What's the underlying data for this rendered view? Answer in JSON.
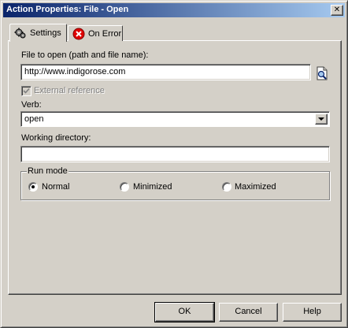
{
  "window": {
    "title": "Action Properties: File - Open",
    "close_label": "✕"
  },
  "tabs": [
    {
      "label": "Settings",
      "icon": "gear-icon",
      "active": true
    },
    {
      "label": "On Error",
      "icon": "error-icon",
      "active": false
    }
  ],
  "form": {
    "file_label": "File to open (path and file name):",
    "file_value": "http://www.indigorose.com",
    "external_reference_label": "External reference",
    "external_reference_checked": true,
    "verb_label": "Verb:",
    "verb_value": "open",
    "working_dir_label": "Working directory:",
    "working_dir_value": ""
  },
  "run_mode": {
    "legend": "Run mode",
    "options": [
      {
        "label": "Normal",
        "selected": true
      },
      {
        "label": "Minimized",
        "selected": false
      },
      {
        "label": "Maximized",
        "selected": false
      }
    ]
  },
  "buttons": {
    "ok": "OK",
    "cancel": "Cancel",
    "help": "Help"
  },
  "colors": {
    "titlebar_start": "#0a246a",
    "titlebar_end": "#a6caf0",
    "face": "#d4d0c8",
    "error_red": "#e00000"
  }
}
